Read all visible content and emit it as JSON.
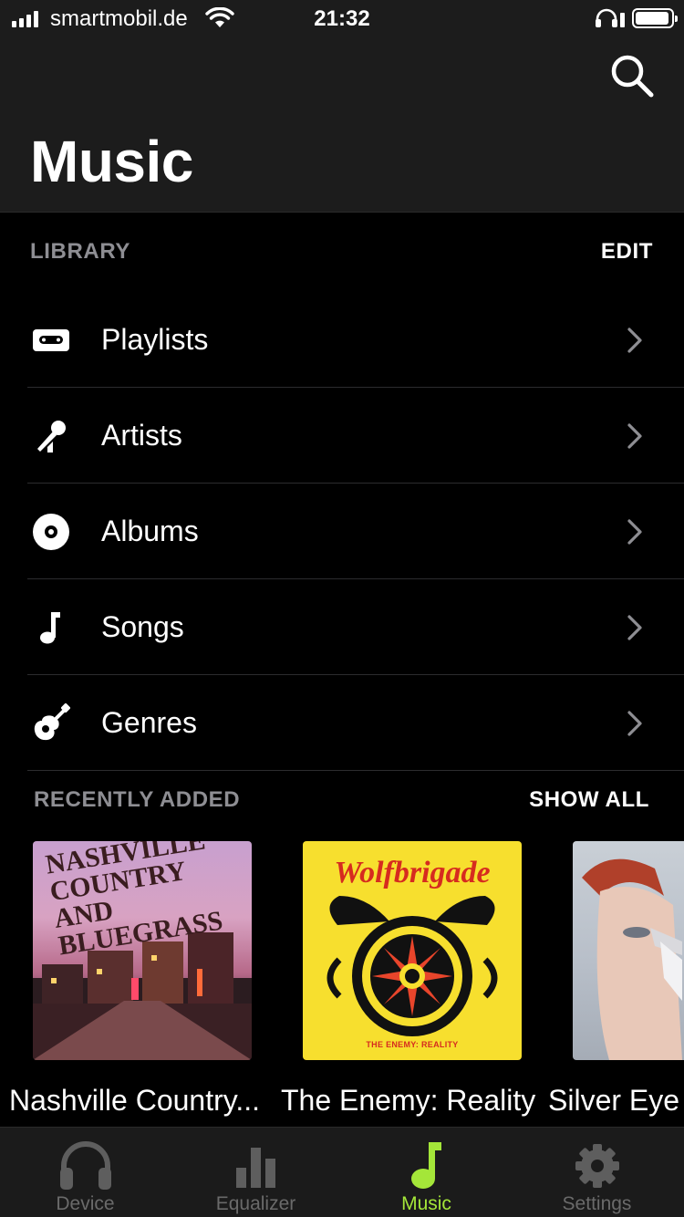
{
  "status_bar": {
    "carrier": "smartmobil.de",
    "time": "21:32"
  },
  "header": {
    "title": "Music",
    "search_icon": "search-icon"
  },
  "library": {
    "label": "LIBRARY",
    "edit_label": "EDIT",
    "items": [
      {
        "label": "Playlists",
        "icon": "cassette-icon"
      },
      {
        "label": "Artists",
        "icon": "microphone-icon"
      },
      {
        "label": "Albums",
        "icon": "vinyl-icon"
      },
      {
        "label": "Songs",
        "icon": "music-note-icon"
      },
      {
        "label": "Genres",
        "icon": "guitar-icon"
      }
    ]
  },
  "recently_added": {
    "label": "RECENTLY ADDED",
    "show_all_label": "SHOW ALL",
    "albums": [
      {
        "title": "Nashville Country...",
        "cover_text": "NASHVILLE COUNTRY AND BLUEGRASS"
      },
      {
        "title": "The Enemy: Reality",
        "cover_text": "Wolfbrigade",
        "cover_subtext": "THE ENEMY: REALITY"
      },
      {
        "title": "Silver Eye"
      }
    ]
  },
  "tab_bar": {
    "tabs": [
      {
        "label": "Device",
        "icon": "headphones-icon",
        "active": false
      },
      {
        "label": "Equalizer",
        "icon": "equalizer-icon",
        "active": false
      },
      {
        "label": "Music",
        "icon": "music-note-icon",
        "active": true
      },
      {
        "label": "Settings",
        "icon": "gear-icon",
        "active": false
      }
    ]
  },
  "colors": {
    "accent": "#a4e639",
    "background": "#000000",
    "header_background": "#1c1c1c",
    "secondary_text": "#8e8e93"
  }
}
